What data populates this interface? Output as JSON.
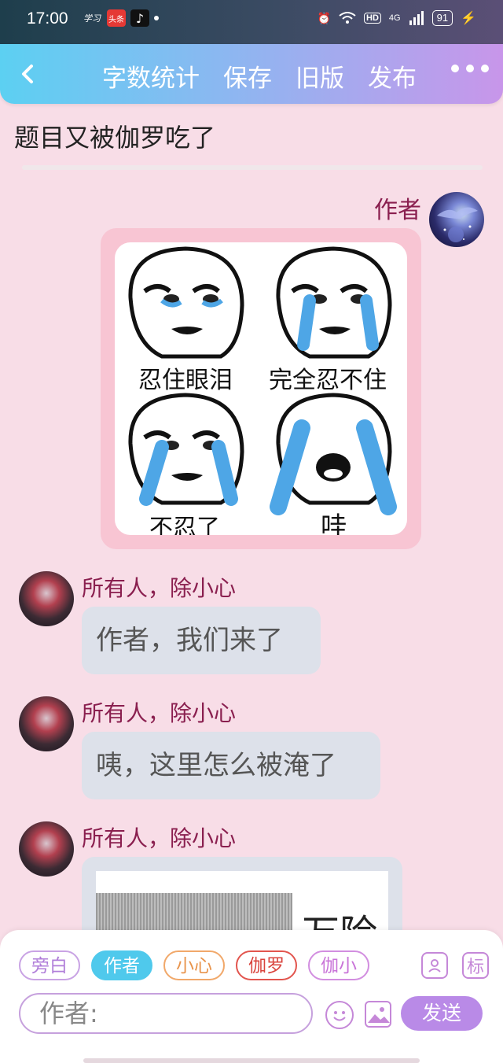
{
  "status_bar": {
    "time": "17:00",
    "app_icons": [
      "学习",
      "头条",
      "抖音"
    ],
    "network": "4G",
    "hd": "HD",
    "battery": "91"
  },
  "nav": {
    "items": [
      "字数统计",
      "保存",
      "旧版",
      "发布"
    ]
  },
  "doc": {
    "title": "题目又被伽罗吃了"
  },
  "messages": [
    {
      "sender": "作者",
      "type": "image",
      "meme_captions": [
        "忍住眼泪",
        "完全忍不住",
        "不忍了",
        "哇"
      ]
    },
    {
      "sender": "所有人，除小心",
      "type": "text",
      "text": "作者，我们来了"
    },
    {
      "sender": "所有人，除小心",
      "type": "text",
      "text": "咦，这里怎么被淹了"
    },
    {
      "sender": "所有人，除小心",
      "type": "image",
      "preview_text": "万险"
    }
  ],
  "composer": {
    "roles": [
      "旁白",
      "作者",
      "小心",
      "伽罗",
      "伽小"
    ],
    "active_role": "作者",
    "role_btn_label": "标",
    "input_value": "作者:",
    "send_label": "发送"
  },
  "colors": {
    "accent": "#4fc9ec",
    "name_color": "#8a1f4f",
    "send": "#b98ae7"
  }
}
